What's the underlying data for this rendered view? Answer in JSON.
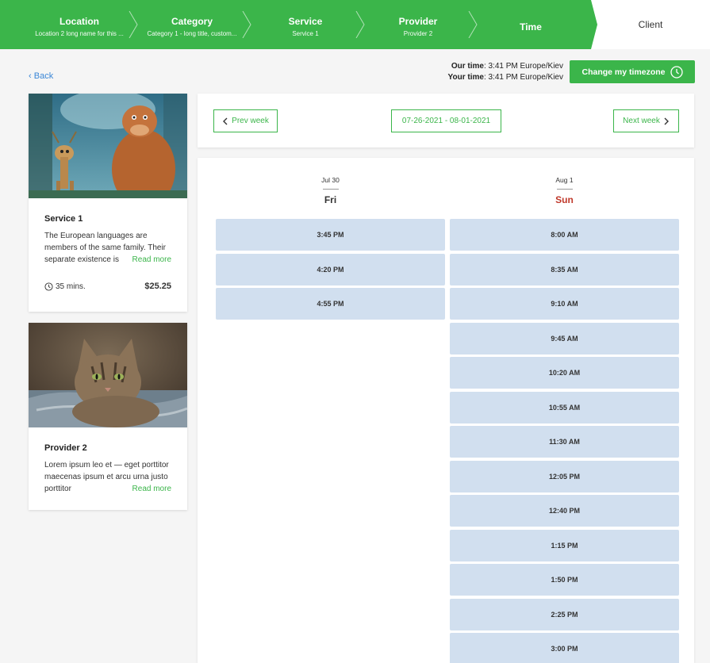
{
  "steps": [
    {
      "title": "Location",
      "sub": "Location 2 long name for this ..."
    },
    {
      "title": "Category",
      "sub": "Category 1 - long title, custom..."
    },
    {
      "title": "Service",
      "sub": "Service 1"
    },
    {
      "title": "Provider",
      "sub": "Provider 2"
    },
    {
      "title": "Time",
      "sub": ""
    },
    {
      "title": "Client",
      "sub": ""
    }
  ],
  "colors": {
    "accent": "#3bb54a",
    "slot": "#d1dfef",
    "link": "#3a86d6",
    "sunday": "#c0392b"
  },
  "back_label": "Back",
  "time_info": {
    "our_label": "Our time",
    "our_value": ": 3:41 PM Europe/Kiev",
    "your_label": "Your time",
    "your_value": ": 3:41 PM Europe/Kiev"
  },
  "timezone_button": "Change my timezone",
  "service_card": {
    "title": "Service 1",
    "desc": "The European languages are members of the same family. Their separate existence is",
    "read_more": "Read more",
    "duration": "35 mins.",
    "price": "$25.25"
  },
  "provider_card": {
    "title": "Provider 2",
    "desc": "Lorem ipsum leo et — eget porttitor maecenas ipsum et arcu urna justo porttitor",
    "read_more": "Read more"
  },
  "week_nav": {
    "prev": "Prev week",
    "range": "07-26-2021 - 08-01-2021",
    "next": "Next week"
  },
  "days": [
    {
      "date": "Jul 30",
      "dow": "Fri",
      "slots": [
        "3:45 PM",
        "4:20 PM",
        "4:55 PM"
      ]
    },
    {
      "date": "Aug 1",
      "dow": "Sun",
      "slots": [
        "8:00 AM",
        "8:35 AM",
        "9:10 AM",
        "9:45 AM",
        "10:20 AM",
        "10:55 AM",
        "11:30 AM",
        "12:05 PM",
        "12:40 PM",
        "1:15 PM",
        "1:50 PM",
        "2:25 PM",
        "3:00 PM"
      ]
    }
  ]
}
